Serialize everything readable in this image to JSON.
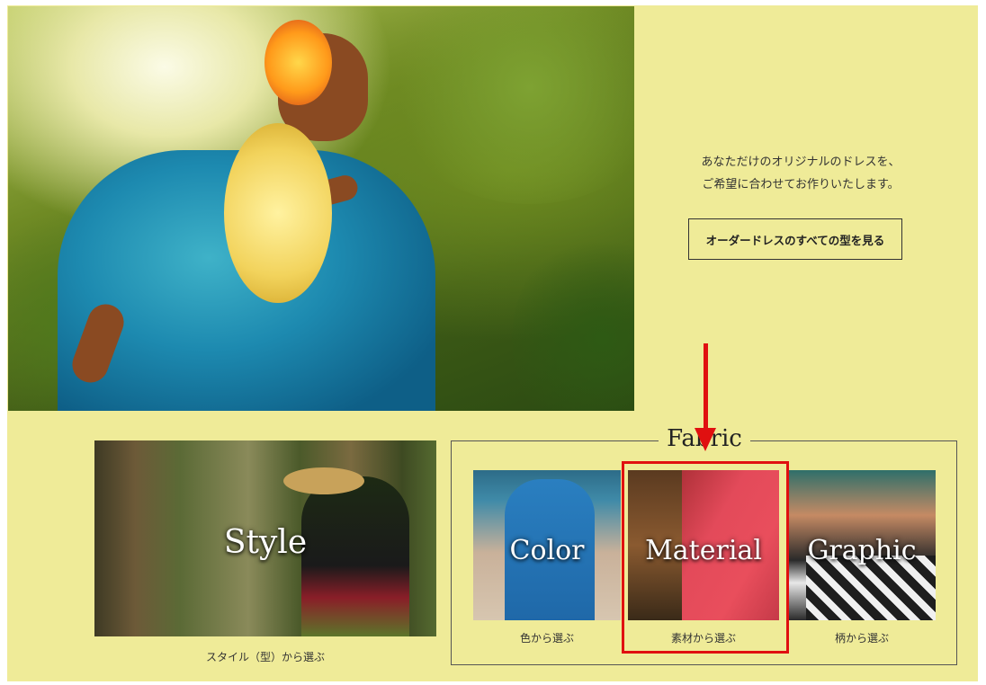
{
  "intro": {
    "line1": "あなただけのオリジナルのドレスを、",
    "line2": "ご希望に合わせてお作りいたします。"
  },
  "all_button_label": "オーダードレスのすべての型を見る",
  "style_card": {
    "label": "Style",
    "caption": "スタイル（型）から選ぶ"
  },
  "fabric": {
    "title": "Fabric",
    "cards": [
      {
        "label": "Color",
        "caption": "色から選ぶ"
      },
      {
        "label": "Material",
        "caption": "素材から選ぶ"
      },
      {
        "label": "Graphic",
        "caption": "柄から選ぶ"
      }
    ]
  },
  "colors": {
    "background": "#efeb98",
    "highlight": "#e01010"
  }
}
